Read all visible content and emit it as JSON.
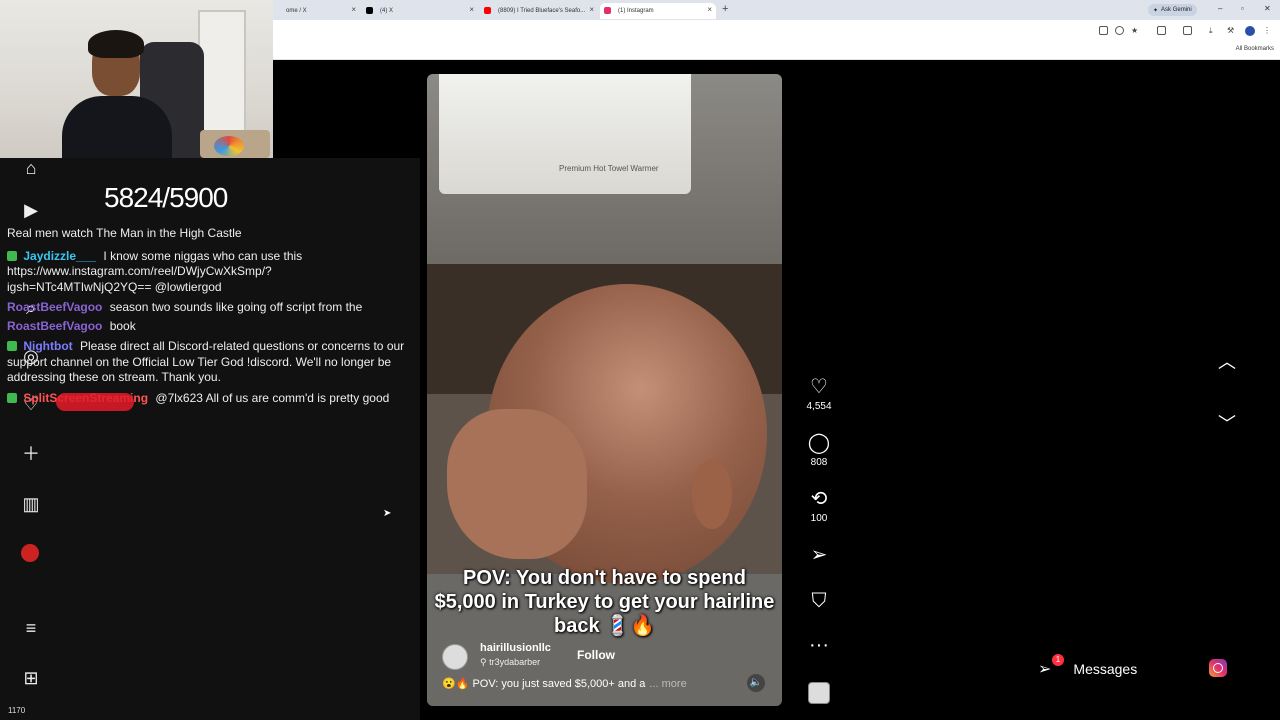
{
  "browser": {
    "tabs": [
      {
        "label": "ome / X",
        "favicon_color": "#ffffff"
      },
      {
        "label": "(4) X",
        "favicon_color": "#000000"
      },
      {
        "label": "(8809) I Tried Blueface's Seafo...",
        "favicon_color": "#ff0000"
      },
      {
        "label": "(1) Instagram",
        "favicon_color": "#e1306c"
      }
    ],
    "ask_gemini": "Ask Gemini",
    "all_bookmarks": "All Bookmarks"
  },
  "stream": {
    "counter": "5824/5900",
    "viewer_count": "1170"
  },
  "chat": {
    "messages": [
      {
        "user": "",
        "text": "Real men watch The Man in the High Castle"
      },
      {
        "user": "Jaydizzle___",
        "text": "I know some niggas who can use this https://www.instagram.com/reel/DWjyCwXkSmp/?igsh=NTc4MTIwNjQ2YQ== @lowtiergod"
      },
      {
        "user": "RoastBeefVagoo",
        "text": "season two sounds like going off script from the"
      },
      {
        "user": "RoastBeefVagoo",
        "text": "book"
      },
      {
        "user": "Nightbot",
        "text": "Please direct all Discord-related questions or concerns to our support channel on the Official Low Tier God !discord. We'll no longer be addressing these on stream. Thank you."
      },
      {
        "user": "SplitScreenStreaming",
        "text": "@7lx623 All of us are comm'd is pretty good"
      }
    ]
  },
  "reel": {
    "warmer_label": "Premium Hot Towel Warmer",
    "caption": "POV: You don't have to spend $5,000 in Turkey to get your hairline back 💈🔥",
    "author": "hairillusionllc",
    "collaborator": "tr3ydabarber",
    "follow_label": "Follow",
    "description": "😮🔥 POV: you just saved $5,000+ and a",
    "more_label": "... more",
    "likes": "4,554",
    "comments": "808",
    "reposts": "100"
  },
  "messages_label": "Messages",
  "messages_badge": "1"
}
